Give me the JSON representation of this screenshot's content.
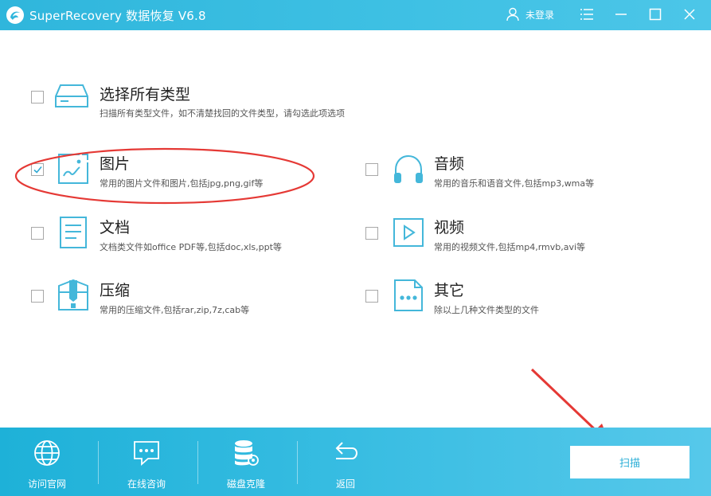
{
  "window": {
    "title": "SuperRecovery 数据恢复 V6.8",
    "user_label": "未登录",
    "controls": [
      "menu-icon",
      "minimize-icon",
      "maximize-icon",
      "close-icon"
    ]
  },
  "options": {
    "all": {
      "title": "选择所有类型",
      "desc": "扫描所有类型文件，如不清楚找回的文件类型，请勾选此项选项",
      "checked": false,
      "icon": "hard-drive-icon"
    },
    "images": {
      "title": "图片",
      "desc": "常用的图片文件和图片,包括jpg,png,gif等",
      "checked": true,
      "icon": "image-icon"
    },
    "audio": {
      "title": "音频",
      "desc": "常用的音乐和语音文件,包括mp3,wma等",
      "checked": false,
      "icon": "headphones-icon"
    },
    "docs": {
      "title": "文档",
      "desc": "文档类文件如office PDF等,包括doc,xls,ppt等",
      "checked": false,
      "icon": "document-icon"
    },
    "video": {
      "title": "视频",
      "desc": "常用的视频文件,包括mp4,rmvb,avi等",
      "checked": false,
      "icon": "play-icon"
    },
    "archive": {
      "title": "压缩",
      "desc": "常用的压缩文件,包括rar,zip,7z,cab等",
      "checked": false,
      "icon": "archive-icon"
    },
    "other": {
      "title": "其它",
      "desc": "除以上几种文件类型的文件",
      "checked": false,
      "icon": "other-file-icon"
    }
  },
  "bottom": {
    "website": "访问官网",
    "consult": "在线咨询",
    "clone": "磁盘克隆",
    "back": "返回",
    "scan": "扫描"
  },
  "colors": {
    "accent": "#3fc1e4",
    "icon": "#44b7da",
    "annotation": "#e53935"
  }
}
